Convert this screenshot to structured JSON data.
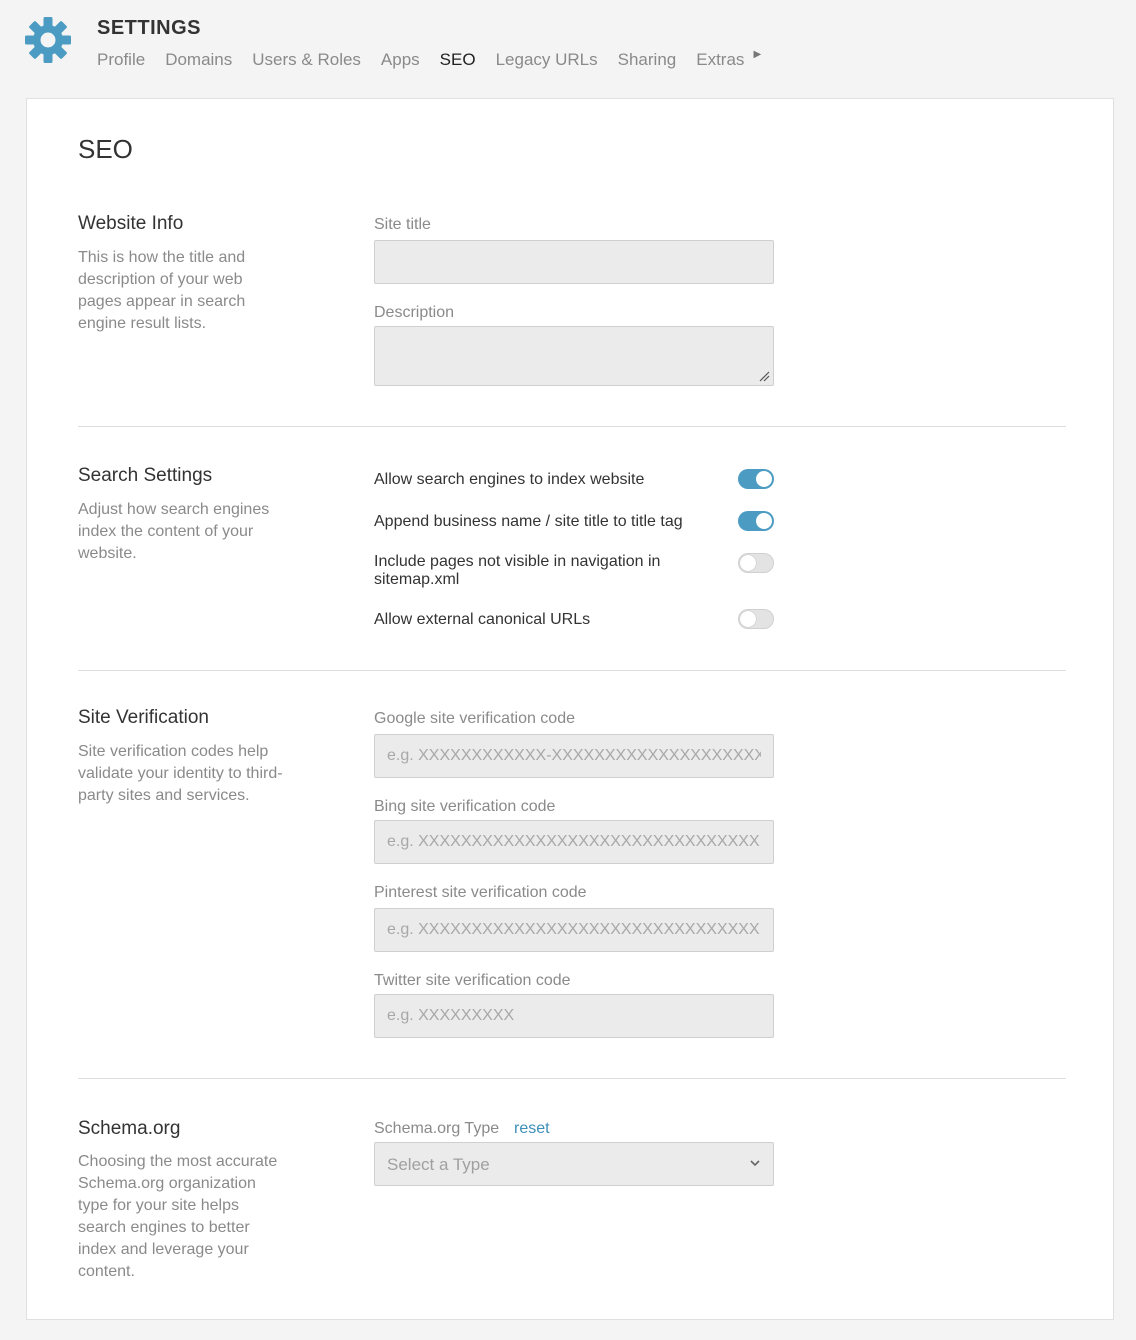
{
  "header": {
    "title": "SETTINGS",
    "icon": "gear-icon",
    "accent": "#4b9bc2",
    "tabs": [
      {
        "label": "Profile"
      },
      {
        "label": "Domains"
      },
      {
        "label": "Users & Roles"
      },
      {
        "label": "Apps"
      },
      {
        "label": "SEO",
        "active": true
      },
      {
        "label": "Legacy URLs"
      },
      {
        "label": "Sharing"
      },
      {
        "label": "Extras"
      }
    ],
    "more_icon": "caret-right-icon"
  },
  "page": {
    "title": "SEO"
  },
  "website_info": {
    "title": "Website Info",
    "description": "This is how the title and description of your web pages appear in search engine result lists.",
    "site_title_label": "Site title",
    "site_title_value": "",
    "description_label": "Description",
    "description_value": ""
  },
  "search_settings": {
    "title": "Search Settings",
    "description": "Adjust how search engines index the content of your website.",
    "toggles": [
      {
        "label": "Allow search engines to index website",
        "on": true
      },
      {
        "label": "Append business name / site title to title tag",
        "on": true
      },
      {
        "label": "Include pages not visible in navigation in sitemap.xml",
        "on": false
      },
      {
        "label": "Allow external canonical URLs",
        "on": false
      }
    ]
  },
  "site_verification": {
    "title": "Site Verification",
    "description": "Site verification codes help validate your identity to third-party sites and services.",
    "fields": [
      {
        "label": "Google site verification code",
        "placeholder": "e.g. XXXXXXXXXXXX-XXXXXXXXXXXXXXXXXXXXXX"
      },
      {
        "label": "Bing site verification code",
        "placeholder": "e.g. XXXXXXXXXXXXXXXXXXXXXXXXXXXXXXXX"
      },
      {
        "label": "Pinterest site verification code",
        "placeholder": "e.g. XXXXXXXXXXXXXXXXXXXXXXXXXXXXXXXX"
      },
      {
        "label": "Twitter site verification code",
        "placeholder": "e.g. XXXXXXXXX"
      }
    ]
  },
  "schema": {
    "title": "Schema.org",
    "description": "Choosing the most accurate Schema.org organization type for your site helps search engines to better index and leverage your content.",
    "type_label": "Schema.org Type",
    "reset_label": "reset",
    "select_placeholder": "Select a Type"
  },
  "colors": {
    "toggle_on": "#4b9bc2",
    "link": "#3d8fb8"
  }
}
